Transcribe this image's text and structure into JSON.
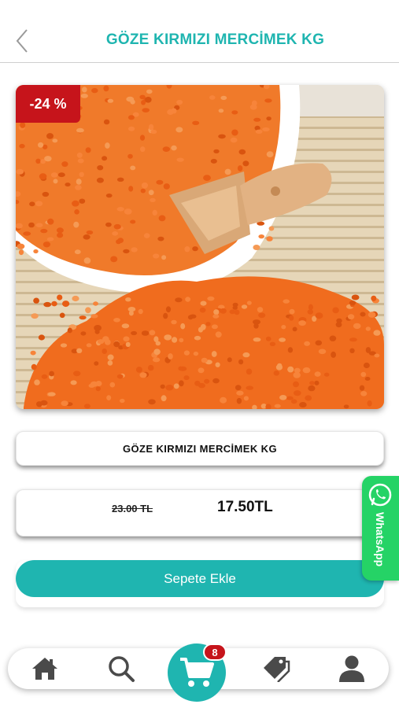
{
  "colors": {
    "accent": "#1fb5b0",
    "badge_red": "#c6141b",
    "whatsapp_green": "#25d366",
    "icon_gray": "#4a4a4a",
    "lentil_orange": "#f26a1c"
  },
  "header": {
    "title": "GÖZE KIRMIZI MERCİMEK KG",
    "back_icon": "chevron-left-icon"
  },
  "product": {
    "discount_badge": "-24 %",
    "name": "GÖZE KIRMIZI MERCİMEK KG",
    "old_price": "23.00 TL",
    "new_price": "17.50TL"
  },
  "actions": {
    "add_to_cart_label": "Sepete Ekle"
  },
  "whatsapp": {
    "label": "WhatsApp",
    "icon": "whatsapp-icon"
  },
  "bottom_nav": {
    "items": [
      {
        "icon": "home-icon"
      },
      {
        "icon": "search-icon"
      },
      {
        "icon": "cart-icon"
      },
      {
        "icon": "tags-icon"
      },
      {
        "icon": "user-icon"
      }
    ],
    "cart_count": "8"
  }
}
